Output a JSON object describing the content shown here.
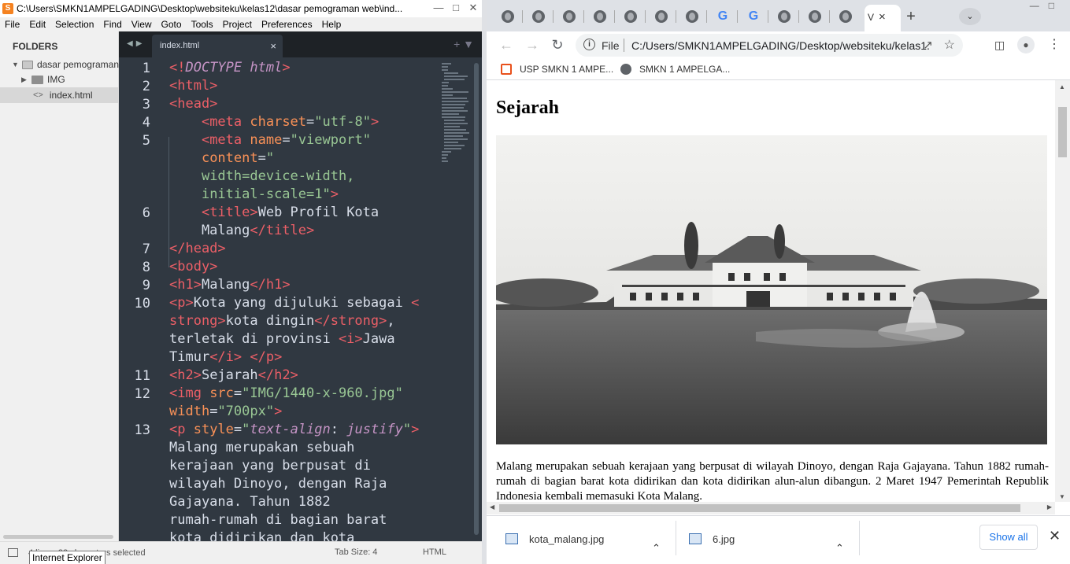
{
  "editor": {
    "window_title": "C:\\Users\\SMKN1AMPELGADING\\Desktop\\websiteku\\kelas12\\dasar pemograman web\\ind...",
    "menu": [
      "File",
      "Edit",
      "Selection",
      "Find",
      "View",
      "Goto",
      "Tools",
      "Project",
      "Preferences",
      "Help"
    ],
    "sidebar": {
      "header": "FOLDERS",
      "items": [
        {
          "label": "dasar pemograman",
          "type": "folder-open"
        },
        {
          "label": "IMG",
          "type": "folder"
        },
        {
          "label": "index.html",
          "type": "file"
        }
      ]
    },
    "tab": {
      "label": "index.html"
    },
    "line_numbers": [
      "1",
      "2",
      "3",
      "4",
      "5",
      "6",
      "7",
      "8",
      "9",
      "10",
      "11",
      "12",
      "13"
    ],
    "status": {
      "selection": "4 lines, 32 characters selected",
      "tab_size": "Tab Size: 4",
      "syntax": "HTML"
    },
    "tooltip": "Internet Explorer"
  },
  "browser": {
    "active_tab_label": "V",
    "url_scheme": "File",
    "url": "C:/Users/SMKN1AMPELGADING/Desktop/websiteku/kelas1...",
    "bookmarks": [
      "USP SMKN 1 AMPE...",
      "SMKN 1 AMPELGA..."
    ],
    "page": {
      "heading": "Sejarah",
      "paragraph": "Malang merupakan sebuah kerajaan yang berpusat di wilayah Dinoyo, dengan Raja Gajayana. Tahun 1882 rumah-rumah di bagian barat kota didirikan dan kota didirikan alun-alun dibangun. 2 Maret 1947 Pemerintah Republik Indonesia kembali memasuki Kota Malang."
    },
    "downloads": [
      {
        "name": "kota_malang.jpg"
      },
      {
        "name": "6.jpg"
      }
    ],
    "show_all": "Show all"
  }
}
